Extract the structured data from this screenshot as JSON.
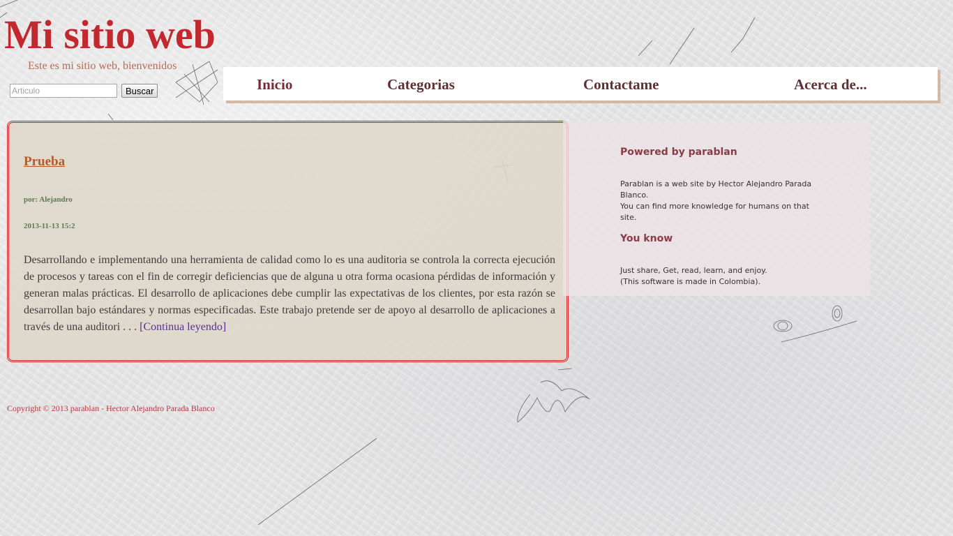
{
  "header": {
    "site_title": "Mi sitio web",
    "tagline": "Este es mi sitio web, bienvenidos"
  },
  "search": {
    "placeholder": "Articulo",
    "value": "",
    "button_label": "Buscar"
  },
  "nav": {
    "items": [
      {
        "label": "Inicio"
      },
      {
        "label": "Categorias"
      },
      {
        "label": "Contactame"
      },
      {
        "label": "Acerca de..."
      }
    ]
  },
  "post": {
    "title": "Prueba",
    "author": "por: Alejandro",
    "date": "2013-11-13 15:2",
    "excerpt": "Desarrollando e implementando una herramienta de calidad como lo es una auditoria se controla la correcta ejecución de procesos y tareas con el fin de corregir deficiencias que de alguna u otra forma ocasiona pérdidas de información y generan malas prácticas. El desarrollo de aplicaciones debe cumplir las expectativas de los clientes, por esta razón se desarrollan bajo estándares y normas especificadas. Este trabajo pretende ser de apoyo al desarrollo de aplicaciones a través de una auditori . . .",
    "read_more": "[Continua leyendo]"
  },
  "sidebar": {
    "sections": [
      {
        "heading": "Powered by parablan",
        "lines": [
          "Parablan is a web site by Hector Alejandro Parada Blanco.",
          "You can find more knowledge for humans on that site."
        ]
      },
      {
        "heading": "You know",
        "lines": [
          "Just share, Get, read, learn, and enjoy.",
          "(This software is made in Colombia)."
        ]
      }
    ]
  },
  "footer": {
    "copyright": "Copyright © 2013 parablan - Hector Alejandro Parada Blanco"
  },
  "colors": {
    "title_red": "#c2282e",
    "nav_text": "#5e2f35",
    "post_border": "#d42a2f",
    "post_title": "#b55a2c",
    "meta_green": "#5f7a52",
    "link_purple": "#5a2f8e",
    "sidebar_heading": "#8a3c46"
  }
}
